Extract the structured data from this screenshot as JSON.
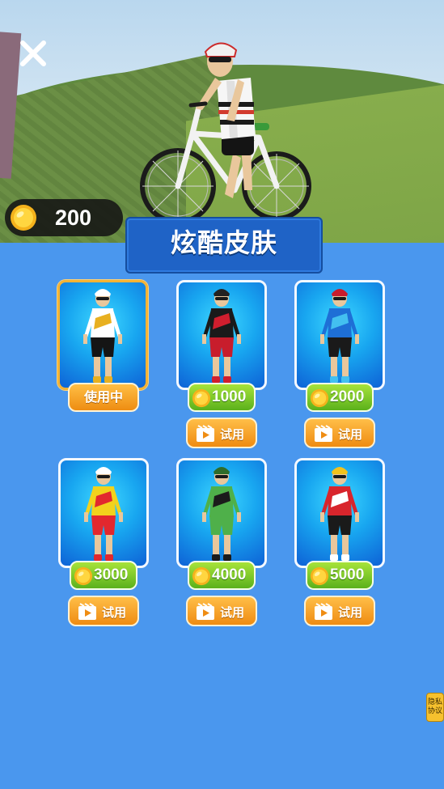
{
  "scene": {
    "background": "3d-hill-with-cyclist"
  },
  "header": {
    "close_icon": "close-x-icon",
    "coin_balance": "200"
  },
  "title": "炫酷皮肤",
  "skins": [
    {
      "status": "使用中",
      "selected": true,
      "colors": {
        "top": "#ffffff",
        "accent": "#e8b020",
        "shorts": "#151515",
        "helmet": "#ffffff"
      }
    },
    {
      "price": "1000",
      "try_label": "试用",
      "colors": {
        "top": "#1a1a1a",
        "accent": "#d01e2e",
        "shorts": "#c81d2c",
        "helmet": "#222222"
      }
    },
    {
      "price": "2000",
      "try_label": "试用",
      "colors": {
        "top": "#1e6fd6",
        "accent": "#43c0f0",
        "shorts": "#1a1a1a",
        "helmet": "#c81d2c"
      }
    },
    {
      "price": "3000",
      "try_label": "试用",
      "colors": {
        "top": "#f2d21c",
        "accent": "#e2282e",
        "shorts": "#e2282e",
        "helmet": "#ffffff"
      }
    },
    {
      "price": "4000",
      "try_label": "试用",
      "colors": {
        "top": "#4fb04a",
        "accent": "#1b1b1b",
        "shorts": "#4fb04a",
        "helmet": "#2f6d2b"
      }
    },
    {
      "price": "5000",
      "try_label": "试用",
      "colors": {
        "top": "#d8252c",
        "accent": "#ffffff",
        "shorts": "#1a1a1a",
        "helmet": "#f2c21c"
      }
    }
  ],
  "privacy_link": "隐私协议",
  "colors": {
    "panel": "#4a97ee",
    "banner": "#1f63c6",
    "price_green": "#6cbf22",
    "try_orange": "#f29a1d"
  }
}
